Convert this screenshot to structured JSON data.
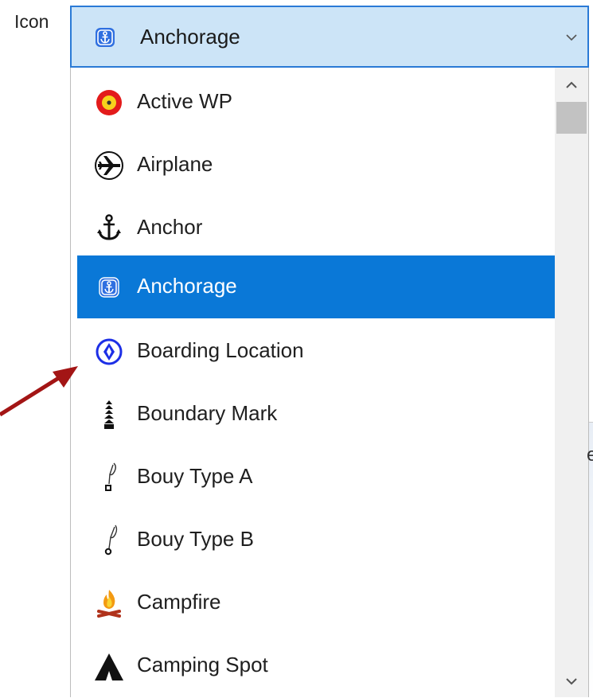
{
  "field": {
    "label": "Icon"
  },
  "combo": {
    "selected": "Anchorage",
    "icon": "anchorage-icon"
  },
  "options": [
    {
      "label": "Active WP",
      "icon": "active-wp-icon"
    },
    {
      "label": "Airplane",
      "icon": "airplane-icon"
    },
    {
      "label": "Anchor",
      "icon": "anchor-icon"
    },
    {
      "label": "Anchorage",
      "icon": "anchorage-icon",
      "selected": true
    },
    {
      "label": "Boarding Location",
      "icon": "boarding-location-icon"
    },
    {
      "label": "Boundary Mark",
      "icon": "boundary-mark-icon"
    },
    {
      "label": "Bouy Type A",
      "icon": "bouy-type-a-icon"
    },
    {
      "label": "Bouy Type B",
      "icon": "bouy-type-b-icon"
    },
    {
      "label": "Campfire",
      "icon": "campfire-icon"
    },
    {
      "label": "Camping Spot",
      "icon": "camping-spot-icon"
    }
  ],
  "colors": {
    "selection": "#0a78d7",
    "combo_bg": "#cce4f7",
    "combo_border": "#2a7ad6",
    "annotation_arrow": "#a31515"
  },
  "background": {
    "partial_glyph": "e"
  }
}
